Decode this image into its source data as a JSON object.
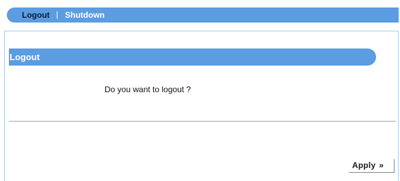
{
  "tabs": {
    "logout": "Logout",
    "separator": "|",
    "shutdown": "Shutdown"
  },
  "section": {
    "title": "Logout",
    "prompt": "Do you want to logout ?"
  },
  "actions": {
    "apply_label": "Apply",
    "apply_chevron": "»"
  },
  "colors": {
    "accent": "#5b9de0",
    "panel_border": "#a9cde7"
  }
}
